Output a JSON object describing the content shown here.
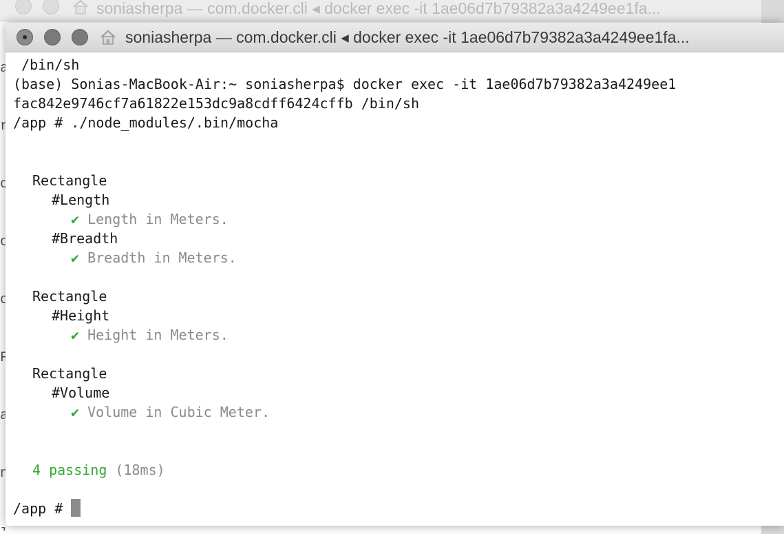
{
  "background_window": {
    "title": "soniasherpa — com.docker.cli ◂ docker exec -it 1ae06d7b79382a3a4249ee1fa...",
    "edge_text": [
      "a",
      "rı",
      "o",
      "o:",
      "o",
      "Fi",
      "a",
      "n",
      "ıp"
    ]
  },
  "window": {
    "title": "soniasherpa — com.docker.cli ◂ docker exec -it 1ae06d7b79382a3a4249ee1fa...",
    "home_icon": "home-icon",
    "traffic_lights": [
      "close",
      "minimize",
      "zoom"
    ]
  },
  "terminal": {
    "lines": {
      "l1": " /bin/sh",
      "l2": "(base) Sonias-MacBook-Air:~ soniasherpa$ docker exec -it 1ae06d7b79382a3a4249ee1",
      "l3": "fac842e9746cf7a61822e153dc9a8cdff6424cffb /bin/sh",
      "l4": "/app # ./node_modules/.bin/mocha",
      "suite1": "Rectangle",
      "suite1_test1": "#Length",
      "suite1_test1_result": "Length in Meters.",
      "suite1_test2": "#Breadth",
      "suite1_test2_result": "Breadth in Meters.",
      "suite2": "Rectangle",
      "suite2_test1": "#Height",
      "suite2_test1_result": "Height in Meters.",
      "suite3": "Rectangle",
      "suite3_test1": "#Volume",
      "suite3_test1_result": "Volume in Cubic Meter.",
      "checkmark": "✔",
      "passing": "4 passing",
      "duration": "(18ms)",
      "prompt": "/app # "
    }
  },
  "colors": {
    "pass_green": "#35a835",
    "muted_gray": "#8a8a8a",
    "cursor": "#8c8c8c"
  }
}
